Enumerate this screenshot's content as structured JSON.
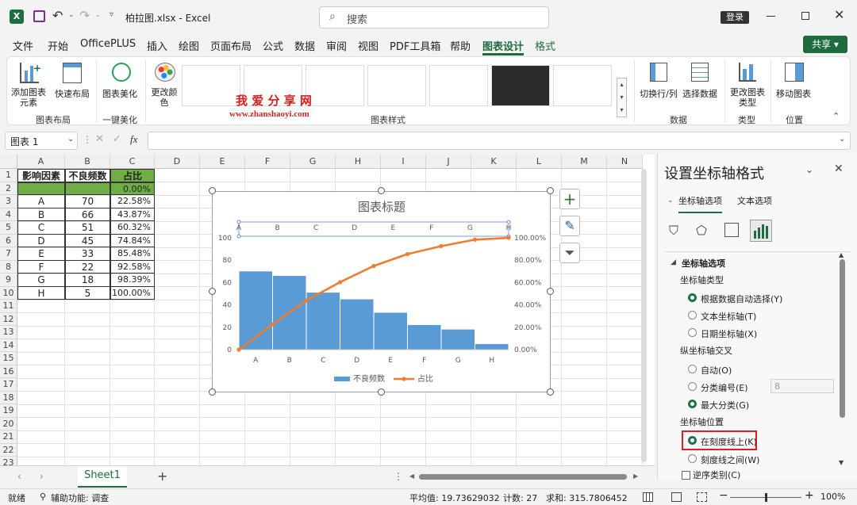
{
  "app": {
    "title": "柏拉图.xlsx  -  Excel",
    "search_placeholder": "搜索",
    "login": "登录",
    "share": "共享"
  },
  "menu": [
    "文件",
    "开始",
    "OfficePLUS",
    "插入",
    "绘图",
    "页面布局",
    "公式",
    "数据",
    "审阅",
    "视图",
    "PDF工具箱",
    "帮助",
    "图表设计",
    "格式"
  ],
  "ribbon": {
    "add_element": "添加图表元素",
    "quick_layout": "快速布局",
    "beautify": "图表美化",
    "change_color": "更改颜色",
    "switch_row_col": "切换行/列",
    "select_data": "选择数据",
    "change_type": "更改图表类型",
    "move_chart": "移动图表",
    "group_layout": "图表布局",
    "group_beautify": "一键美化",
    "group_styles": "图表样式",
    "group_data": "数据",
    "group_type": "类型",
    "group_location": "位置",
    "watermark_cn": "我 爱 分 享 网",
    "watermark_url": "www.zhanshaoyi.com"
  },
  "formula": {
    "namebox": "图表 1",
    "fx": "fx",
    "value": ""
  },
  "columns": [
    "A",
    "B",
    "C",
    "D",
    "E",
    "F",
    "G",
    "H",
    "I",
    "J",
    "K",
    "L",
    "M",
    "N"
  ],
  "rows": [
    "1",
    "2",
    "3",
    "4",
    "5",
    "6",
    "7",
    "8",
    "9",
    "10",
    "11",
    "12",
    "13",
    "14",
    "15",
    "16",
    "17",
    "18",
    "19",
    "20",
    "21",
    "22",
    "23"
  ],
  "table": {
    "headers": [
      "影响因素",
      "不良频数",
      "占比"
    ],
    "row2": [
      "",
      "",
      "0.00%"
    ],
    "data": [
      [
        "A",
        "70",
        "22.58%"
      ],
      [
        "B",
        "66",
        "43.87%"
      ],
      [
        "C",
        "51",
        "60.32%"
      ],
      [
        "D",
        "45",
        "74.84%"
      ],
      [
        "E",
        "33",
        "85.48%"
      ],
      [
        "F",
        "22",
        "92.58%"
      ],
      [
        "G",
        "18",
        "98.39%"
      ],
      [
        "H",
        "5",
        "100.00%"
      ]
    ]
  },
  "chart_data": {
    "type": "bar",
    "title": "图表标题",
    "categories": [
      "A",
      "B",
      "C",
      "D",
      "E",
      "F",
      "G",
      "H"
    ],
    "series": [
      {
        "name": "不良频数",
        "type": "bar",
        "values": [
          70,
          66,
          51,
          45,
          33,
          22,
          18,
          5
        ]
      },
      {
        "name": "占比",
        "type": "line",
        "axis": "secondary",
        "values": [
          22.58,
          43.87,
          60.32,
          74.84,
          85.48,
          92.58,
          98.39,
          100.0
        ],
        "start": 0
      }
    ],
    "ylim": [
      0,
      100
    ],
    "yticks": [
      "0",
      "20",
      "40",
      "60",
      "80",
      "100"
    ],
    "y2ticks": [
      "0.00%",
      "20.00%",
      "40.00%",
      "60.00%",
      "80.00%",
      "100.00%"
    ],
    "secondary_x_categories": [
      "A",
      "B",
      "C",
      "D",
      "E",
      "F",
      "G",
      "H"
    ],
    "legend_position": "bottom",
    "grid": false,
    "colors": {
      "bar": "#5b9bd5",
      "line": "#ed7d31"
    }
  },
  "pane": {
    "title": "设置坐标轴格式",
    "tab1": "坐标轴选项",
    "tab2": "文本选项",
    "section": "坐标轴选项",
    "axis_type_label": "坐标轴类型",
    "axis_types": [
      "根据数据自动选择(Y)",
      "文本坐标轴(T)",
      "日期坐标轴(X)"
    ],
    "cross_label": "纵坐标轴交叉",
    "cross": [
      "自动(O)",
      "分类编号(E)",
      "最大分类(G)"
    ],
    "cross_num": "8",
    "pos_label": "坐标轴位置",
    "pos": [
      "在刻度线上(K)",
      "刻度线之间(W)"
    ],
    "reverse": "逆序类别(C)"
  },
  "sheet": {
    "tab": "Sheet1",
    "add": "+"
  },
  "status": {
    "ready": "就绪",
    "accessibility": "辅助功能: 调查",
    "average": "平均值: 19.73629032",
    "count": "计数: 27",
    "sum": "求和: 315.7806452",
    "zoom": "100%"
  }
}
